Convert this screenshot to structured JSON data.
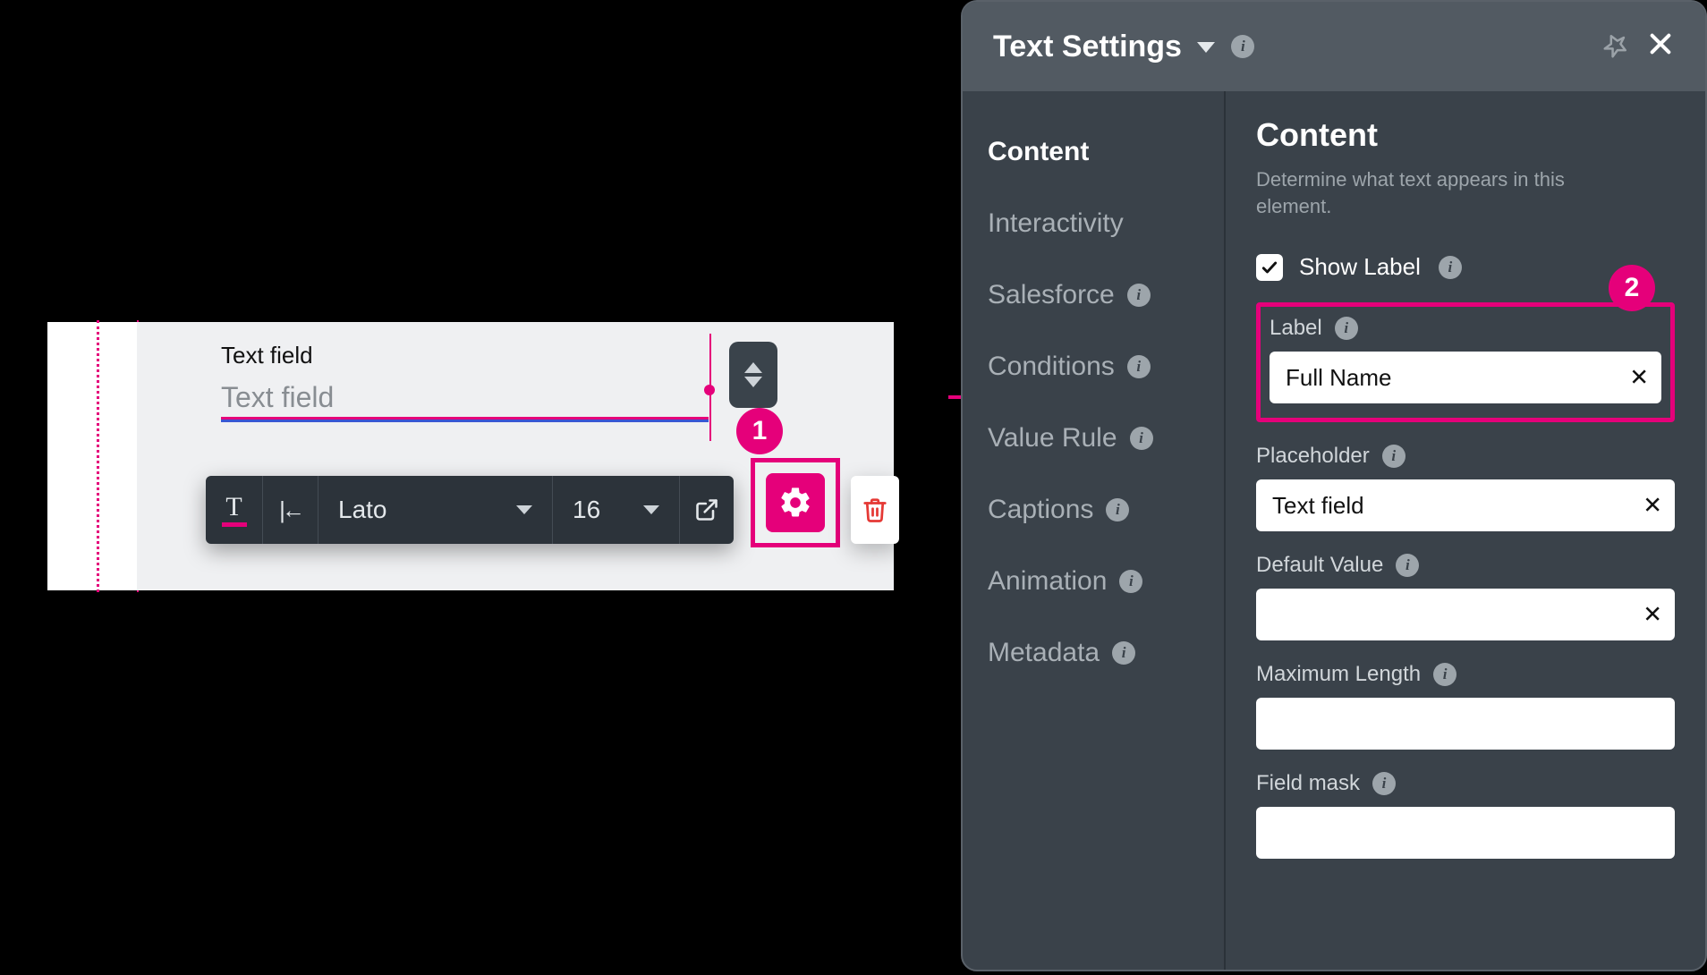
{
  "canvas": {
    "field_label": "Text field",
    "field_placeholder": "Text field"
  },
  "toolbar": {
    "font": "Lato",
    "size": "16"
  },
  "badges": {
    "one": "1",
    "two": "2"
  },
  "panel": {
    "title": "Text Settings",
    "sidebar": [
      {
        "label": "Content",
        "has_info": false,
        "active": true
      },
      {
        "label": "Interactivity",
        "has_info": false,
        "active": false
      },
      {
        "label": "Salesforce",
        "has_info": true,
        "active": false
      },
      {
        "label": "Conditions",
        "has_info": true,
        "active": false
      },
      {
        "label": "Value Rule",
        "has_info": true,
        "active": false
      },
      {
        "label": "Captions",
        "has_info": true,
        "active": false
      },
      {
        "label": "Animation",
        "has_info": true,
        "active": false
      },
      {
        "label": "Metadata",
        "has_info": true,
        "active": false
      }
    ],
    "main": {
      "heading": "Content",
      "description": "Determine what text appears in this element.",
      "show_label": "Show Label",
      "fields": {
        "label": {
          "label": "Label",
          "value": "Full Name"
        },
        "placeholder": {
          "label": "Placeholder",
          "value": "Text field"
        },
        "default_value": {
          "label": "Default Value",
          "value": ""
        },
        "max_length": {
          "label": "Maximum Length",
          "value": ""
        },
        "field_mask": {
          "label": "Field mask",
          "value": ""
        }
      }
    }
  }
}
